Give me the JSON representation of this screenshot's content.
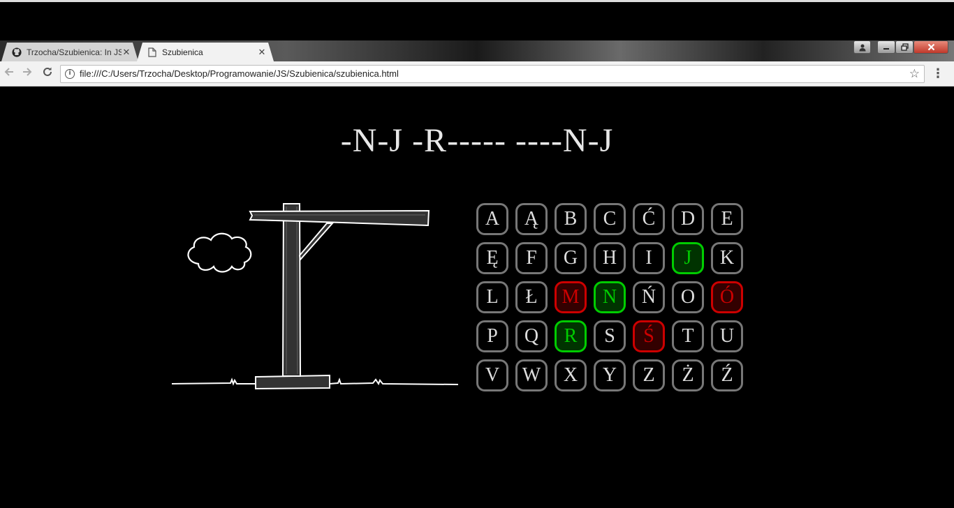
{
  "browser": {
    "tabs": [
      {
        "title": "Trzocha/Szubienica: In JS",
        "active": false,
        "icon": "github-icon"
      },
      {
        "title": "Szubienica",
        "active": true,
        "icon": "page-icon"
      }
    ],
    "close_glyph": "✕",
    "url": "file:///C:/Users/Trzocha/Desktop/Programowanie/JS/Szubienica/szubienica.html"
  },
  "game": {
    "puzzle": "-N-J -R----- ----N-J",
    "letters": [
      {
        "char": "A",
        "state": "unused"
      },
      {
        "char": "Ą",
        "state": "unused"
      },
      {
        "char": "B",
        "state": "unused"
      },
      {
        "char": "C",
        "state": "unused"
      },
      {
        "char": "Ć",
        "state": "unused"
      },
      {
        "char": "D",
        "state": "unused"
      },
      {
        "char": "E",
        "state": "unused"
      },
      {
        "char": "Ę",
        "state": "unused"
      },
      {
        "char": "F",
        "state": "unused"
      },
      {
        "char": "G",
        "state": "unused"
      },
      {
        "char": "H",
        "state": "unused"
      },
      {
        "char": "I",
        "state": "unused"
      },
      {
        "char": "J",
        "state": "hit"
      },
      {
        "char": "K",
        "state": "unused"
      },
      {
        "char": "L",
        "state": "unused"
      },
      {
        "char": "Ł",
        "state": "unused"
      },
      {
        "char": "M",
        "state": "miss"
      },
      {
        "char": "N",
        "state": "hit"
      },
      {
        "char": "Ń",
        "state": "unused"
      },
      {
        "char": "O",
        "state": "unused"
      },
      {
        "char": "Ó",
        "state": "miss"
      },
      {
        "char": "P",
        "state": "unused"
      },
      {
        "char": "Q",
        "state": "unused"
      },
      {
        "char": "R",
        "state": "hit"
      },
      {
        "char": "S",
        "state": "unused"
      },
      {
        "char": "Ś",
        "state": "miss"
      },
      {
        "char": "T",
        "state": "unused"
      },
      {
        "char": "U",
        "state": "unused"
      },
      {
        "char": "V",
        "state": "unused"
      },
      {
        "char": "W",
        "state": "unused"
      },
      {
        "char": "X",
        "state": "unused"
      },
      {
        "char": "Y",
        "state": "unused"
      },
      {
        "char": "Z",
        "state": "unused"
      },
      {
        "char": "Ż",
        "state": "unused"
      },
      {
        "char": "Ź",
        "state": "unused"
      }
    ],
    "colors": {
      "hit": "#00cc00",
      "miss": "#cc0000",
      "unused_border": "#777777",
      "text": "#dddddd"
    }
  }
}
